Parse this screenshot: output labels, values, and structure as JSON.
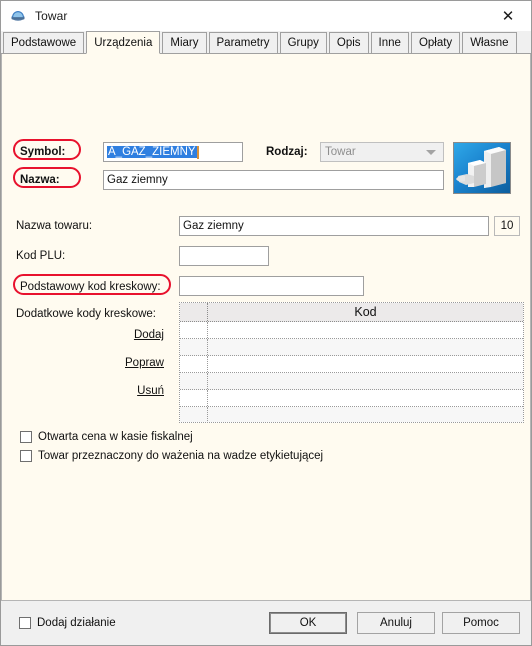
{
  "window": {
    "title": "Towar",
    "icon": "product-window-icon",
    "close_label": "✕"
  },
  "tabs": [
    {
      "label": "Podstawowe",
      "selected": false
    },
    {
      "label": "Urządzenia",
      "selected": true
    },
    {
      "label": "Miary",
      "selected": false
    },
    {
      "label": "Parametry",
      "selected": false
    },
    {
      "label": "Grupy",
      "selected": false
    },
    {
      "label": "Opis",
      "selected": false
    },
    {
      "label": "Inne",
      "selected": false
    },
    {
      "label": "Opłaty",
      "selected": false
    },
    {
      "label": "Własne",
      "selected": false
    }
  ],
  "header": {
    "symbol_label": "Symbol:",
    "symbol_value": "A_GAZ_ZIEMNY",
    "symbol_selected": true,
    "nazwa_label": "Nazwa:",
    "nazwa_value": "Gaz ziemny",
    "rodzaj_label": "Rodzaj:",
    "rodzaj_value": "Towar",
    "rodzaj_disabled": true,
    "product_image": "packages-icon"
  },
  "form": {
    "nazwa_towaru_label": "Nazwa towaru:",
    "nazwa_towaru_value": "Gaz ziemny",
    "nazwa_towaru_counter": "10",
    "kod_plu_label": "Kod PLU:",
    "kod_plu_value": "",
    "podstawowy_kod_label": "Podstawowy kod kreskowy:",
    "podstawowy_kod_value": "",
    "dodatkowe_kody_label": "Dodatkowe kody kreskowe:"
  },
  "grid_actions": [
    {
      "label": "Dodaj"
    },
    {
      "label": "Popraw"
    },
    {
      "label": "Usuń"
    }
  ],
  "grid": {
    "columns": [
      "",
      "Kod"
    ],
    "rows": [
      {
        "num": "",
        "kod": ""
      },
      {
        "num": "",
        "kod": ""
      },
      {
        "num": "",
        "kod": ""
      },
      {
        "num": "",
        "kod": ""
      },
      {
        "num": "",
        "kod": ""
      },
      {
        "num": "",
        "kod": ""
      }
    ]
  },
  "checkboxes": [
    {
      "label": "Otwarta cena w kasie fiskalnej",
      "checked": false
    },
    {
      "label": "Towar przeznaczony do ważenia na wadze etykietującej",
      "checked": false
    }
  ],
  "footer": {
    "dodaj_dzialanie_label": "Dodaj działanie",
    "dodaj_dzialanie_checked": false,
    "ok_label": "OK",
    "anuluj_label": "Anuluj",
    "pomoc_label": "Pomoc"
  },
  "annotations": {
    "color": "#e8112d",
    "targets": [
      "Symbol:",
      "Nazwa:",
      "Podstawowy kod kreskowy:"
    ]
  }
}
